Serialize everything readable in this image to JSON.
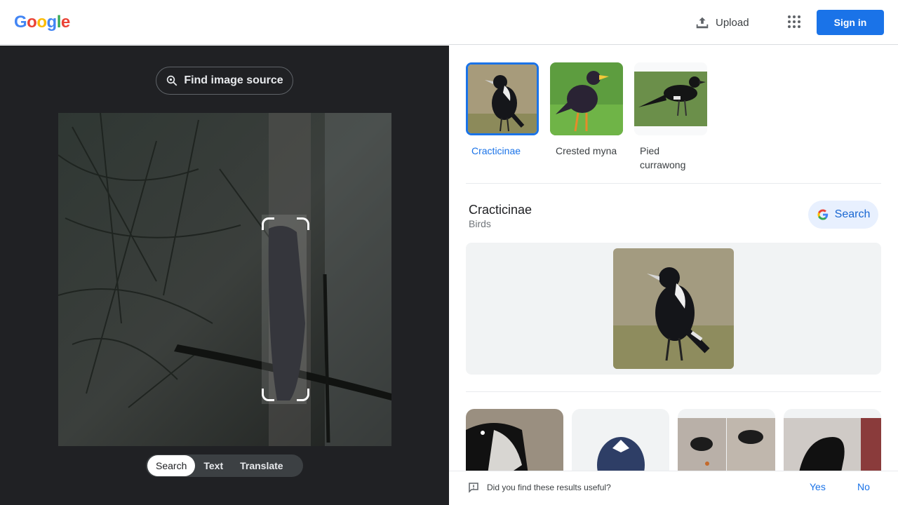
{
  "header": {
    "logo_letters": [
      {
        "ch": "G",
        "color": "#4285F4"
      },
      {
        "ch": "o",
        "color": "#EA4335"
      },
      {
        "ch": "o",
        "color": "#FBBC05"
      },
      {
        "ch": "g",
        "color": "#4285F4"
      },
      {
        "ch": "l",
        "color": "#34A853"
      },
      {
        "ch": "e",
        "color": "#EA4335"
      }
    ],
    "upload_label": "Upload",
    "upload_icon": "upload-icon",
    "apps_icon": "apps-grid-icon",
    "signin_label": "Sign in"
  },
  "left_panel": {
    "find_source_label": "Find image source",
    "find_source_icon": "lens-search-icon",
    "mode_tabs": [
      {
        "label": "Search",
        "active": true
      },
      {
        "label": "Text",
        "active": false
      },
      {
        "label": "Translate",
        "active": false
      }
    ]
  },
  "right_panel": {
    "chips": [
      {
        "label": "Cracticinae",
        "active": true
      },
      {
        "label": "Crested myna",
        "active": false
      },
      {
        "label": "Pied currawong",
        "active": false
      }
    ],
    "entity": {
      "title": "Cracticinae",
      "subtitle": "Birds",
      "search_label": "Search"
    },
    "feedback": {
      "question": "Did you find these results useful?",
      "yes": "Yes",
      "no": "No"
    }
  },
  "colors": {
    "accent": "#1a73e8",
    "dark_panel": "#202124"
  }
}
